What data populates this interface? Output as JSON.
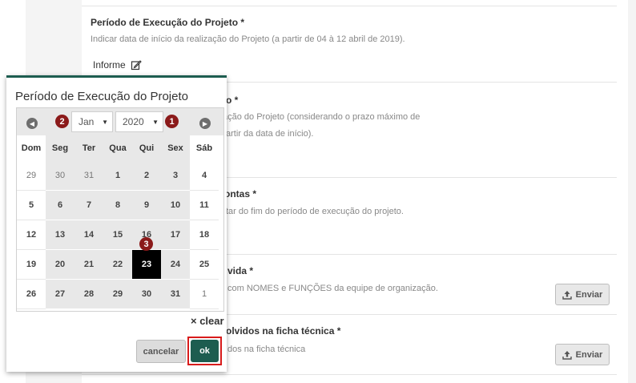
{
  "form": {
    "fields": [
      {
        "title": "Período de Execução do Projeto *",
        "desc": "Indicar data de início da realização do Projeto (a partir de 04 à 12 abril de 2019)."
      },
      {
        "title": "to *",
        "desc1": "ação do Projeto (considerando o prazo máximo de",
        "desc2": "artir da data de início)."
      },
      {
        "title": "ontas *",
        "desc": "tar do fim do período de execução do projeto."
      },
      {
        "title": "vida *",
        "desc": "com NOMES e FUNÇÕES da equipe de organização."
      },
      {
        "title": "olvidos na ficha técnica *",
        "desc": "dos na ficha técnica"
      }
    ],
    "informe_label": "Informe",
    "enviar_label": "Enviar"
  },
  "picker": {
    "title": "Período de Execução do Projeto",
    "month": "Jan",
    "year": "2020",
    "badges": [
      "1",
      "2",
      "3"
    ],
    "weekdays": [
      "Dom",
      "Seg",
      "Ter",
      "Qua",
      "Qui",
      "Sex",
      "Sáb"
    ],
    "weeks": [
      [
        "29",
        "30",
        "31",
        "1",
        "2",
        "3",
        "4"
      ],
      [
        "5",
        "6",
        "7",
        "8",
        "9",
        "10",
        "11"
      ],
      [
        "12",
        "13",
        "14",
        "15",
        "16",
        "17",
        "18"
      ],
      [
        "19",
        "20",
        "21",
        "22",
        "23",
        "24",
        "25"
      ],
      [
        "26",
        "27",
        "28",
        "29",
        "30",
        "31",
        "1"
      ]
    ],
    "selected_day": "23",
    "clear_label": "× clear",
    "cancel_label": "cancelar",
    "ok_label": "ok",
    "accent_color": "#1d5d50",
    "highlight_color": "#d81b1b"
  }
}
